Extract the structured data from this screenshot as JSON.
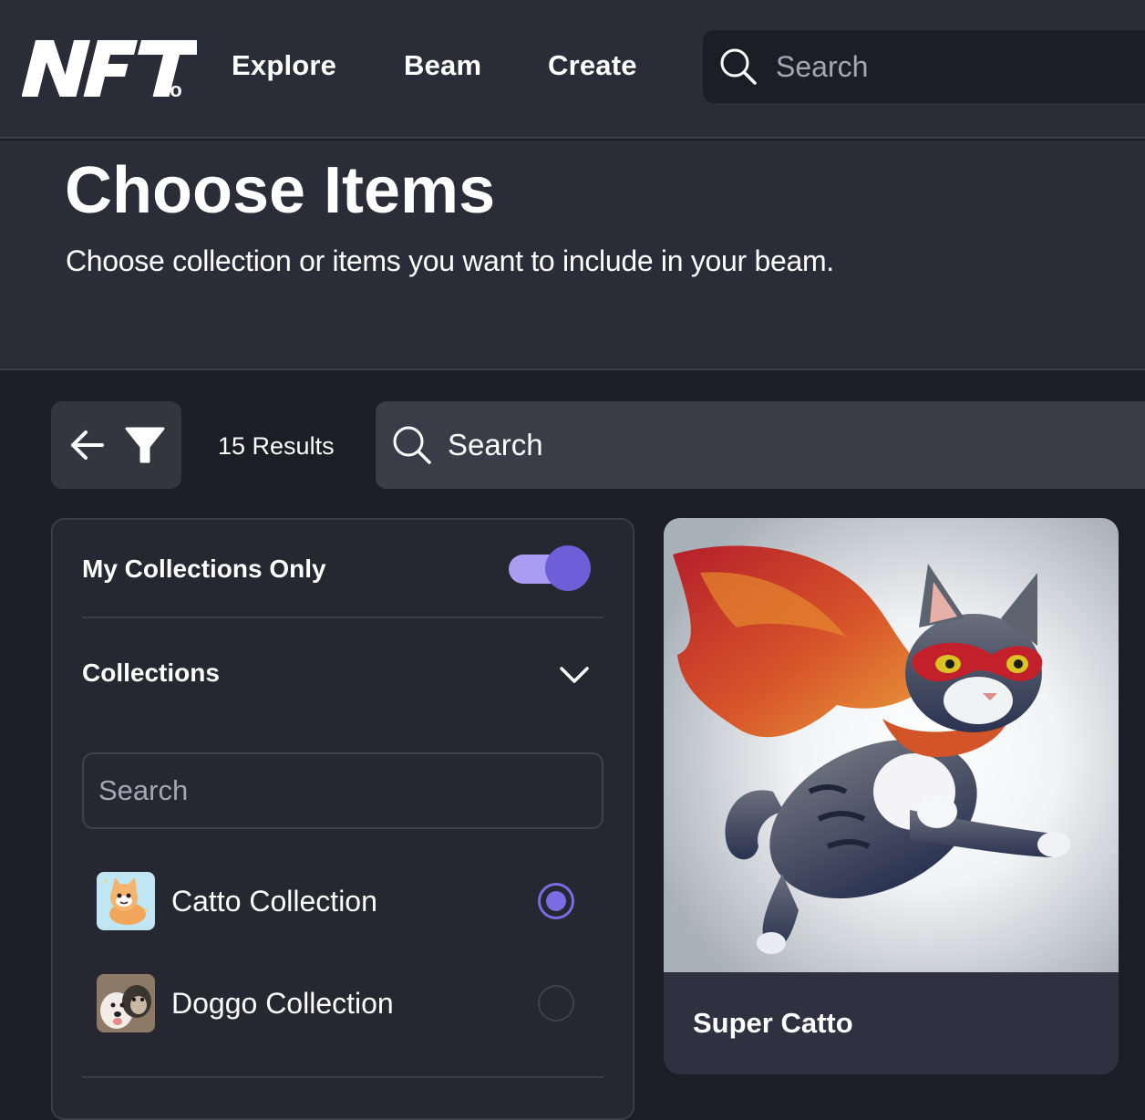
{
  "brand": {
    "logo_main": "NFT",
    "logo_suffix": ".io"
  },
  "nav": {
    "links": [
      "Explore",
      "Beam",
      "Create"
    ],
    "search_placeholder": "Search"
  },
  "header": {
    "title": "Choose Items",
    "subtitle": "Choose collection or items you want to include in your beam."
  },
  "toolbar": {
    "results": "15 Results",
    "search_placeholder": "Search"
  },
  "filters": {
    "my_collections_label": "My Collections Only",
    "my_collections_on": true,
    "collections_label": "Collections",
    "collection_search_placeholder": "Search",
    "collections": [
      {
        "name": "Catto Collection",
        "selected": true
      },
      {
        "name": "Doggo Collection",
        "selected": false
      }
    ]
  },
  "items": [
    {
      "name": "Super Catto"
    }
  ],
  "colors": {
    "accent": "#6e5fd6",
    "accent_light": "#a99cf2",
    "background": "#1c1e26",
    "surface": "#2a2c37"
  },
  "icons": [
    "search-icon",
    "arrow-left-icon",
    "filter-icon",
    "chevron-down-icon"
  ]
}
